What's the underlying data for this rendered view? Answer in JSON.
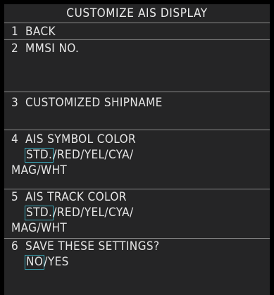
{
  "menu": {
    "title": "CUSTOMIZE AIS DISPLAY",
    "items": [
      {
        "number": "1",
        "label": "BACK"
      },
      {
        "number": "2",
        "label": "MMSI NO."
      },
      {
        "number": "3",
        "label": "CUSTOMIZED SHIPNAME"
      },
      {
        "number": "4",
        "label": "AIS SYMBOL COLOR",
        "options": [
          "STD.",
          "RED",
          "YEL",
          "CYA",
          "MAG",
          "WHT"
        ],
        "selected": "STD."
      },
      {
        "number": "5",
        "label": "AIS TRACK COLOR",
        "options": [
          "STD.",
          "RED",
          "YEL",
          "CYA",
          "MAG",
          "WHT"
        ],
        "selected": "STD."
      },
      {
        "number": "6",
        "label": "SAVE THESE SETTINGS?",
        "options": [
          "NO",
          "YES"
        ],
        "selected": "NO"
      }
    ],
    "separator": "/"
  },
  "colors": {
    "background": "#000000",
    "panel": "#252526",
    "text": "#e6e6e6",
    "divider": "#8a8a8a",
    "selection_box": "#39a6b8"
  }
}
